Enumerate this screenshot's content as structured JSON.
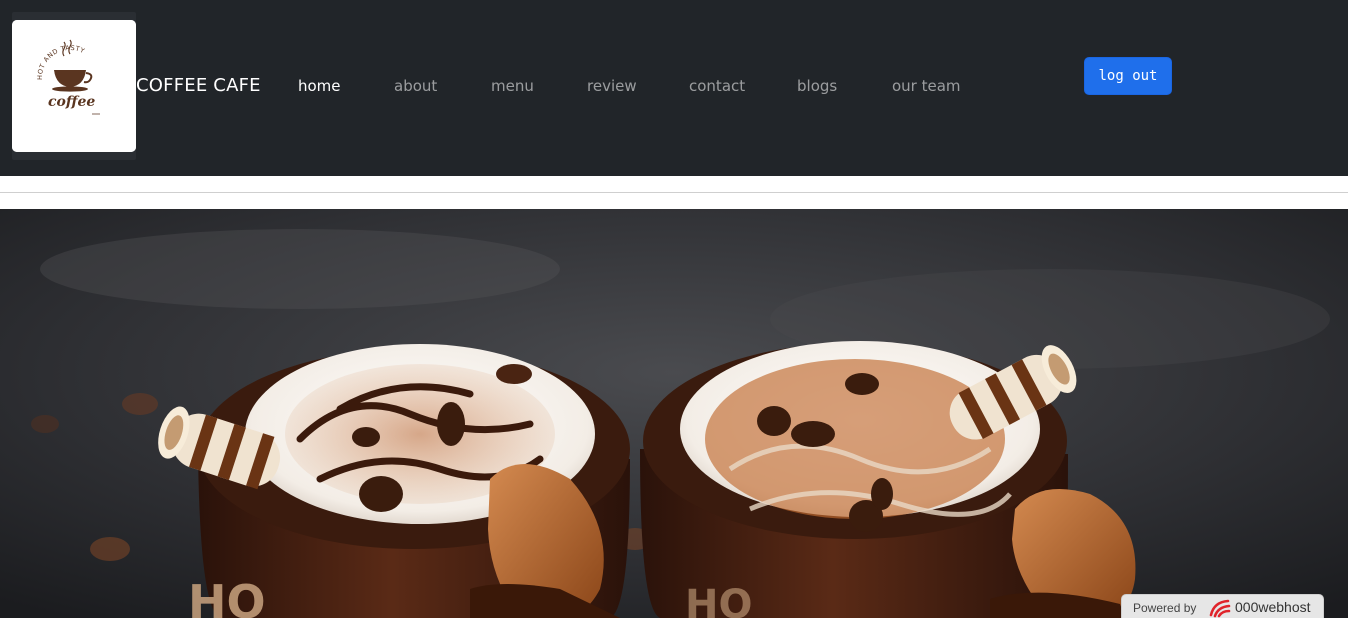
{
  "navbar": {
    "logo_image": "coffee-cup-logo",
    "logo_text": {
      "arc": "HOT AND TASTY",
      "word": "coffee"
    },
    "brand": "COFFEE CAFE",
    "links": [
      {
        "label": "home",
        "active": true
      },
      {
        "label": "about",
        "active": false
      },
      {
        "label": "menu",
        "active": false
      },
      {
        "label": "review",
        "active": false
      },
      {
        "label": "contact",
        "active": false
      },
      {
        "label": "blogs",
        "active": false
      },
      {
        "label": "our team",
        "active": false
      }
    ],
    "logout_label": "log out"
  },
  "hero": {
    "image": "two-hot-chocolate-mugs-with-whipped-cream-and-wafer-rolls",
    "mug_text": "HO"
  },
  "badge": {
    "prefix": "Powered by",
    "name": "000webhost"
  },
  "colors": {
    "navbar_bg": "#212529",
    "button_primary": "#1f6feb",
    "nav_text_active": "#ffffff",
    "nav_text_muted": "#8c8f92"
  }
}
